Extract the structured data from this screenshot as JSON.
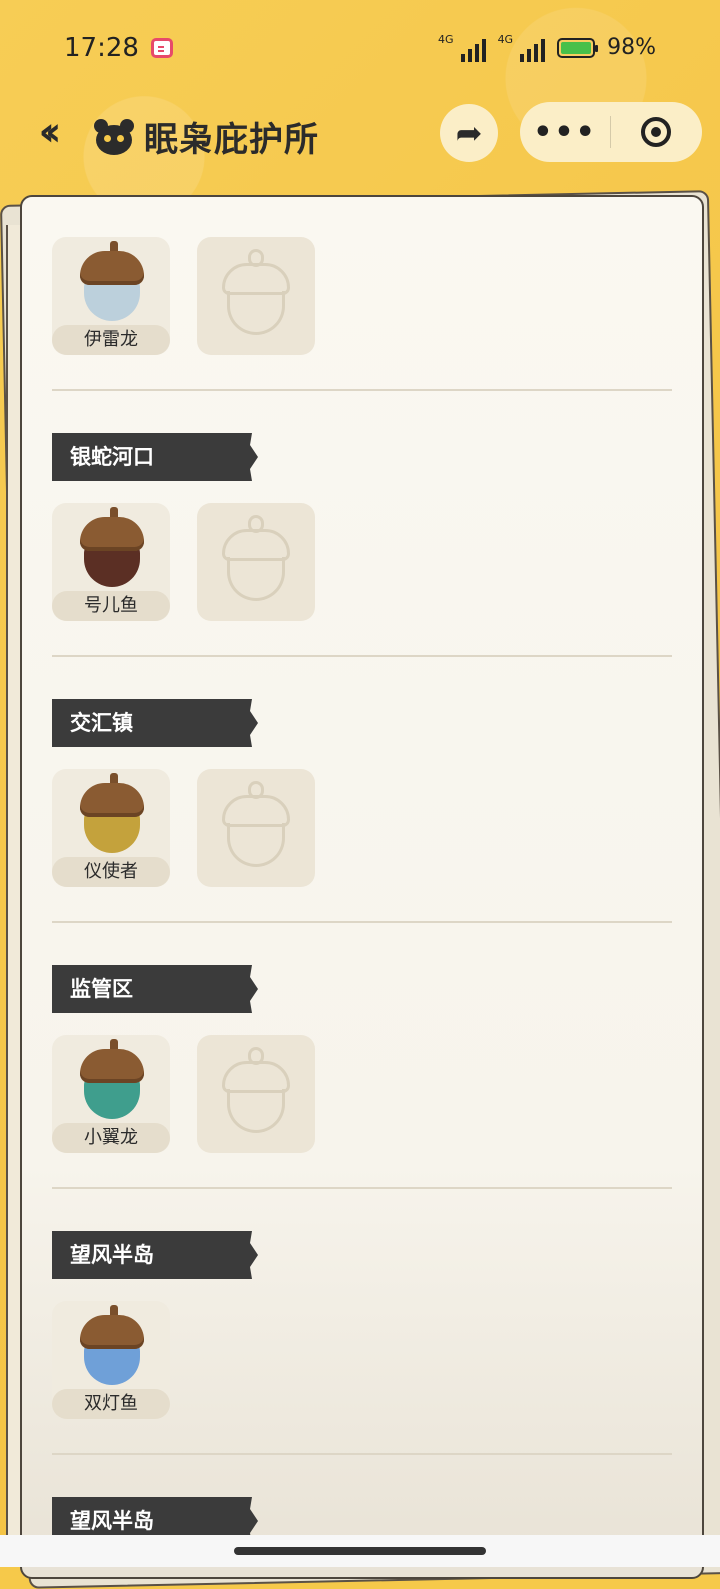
{
  "status_bar": {
    "time": "17:28",
    "network1": "4G",
    "network2": "4G",
    "battery": "98%"
  },
  "nav": {
    "title": "眠枭庇护所"
  },
  "sections": [
    {
      "region": "",
      "items": [
        {
          "name": "伊雷龙",
          "body_color": "#bcd0dc",
          "filled": true
        },
        {
          "filled": false
        }
      ]
    },
    {
      "region": "银蛇河口",
      "items": [
        {
          "name": "号儿鱼",
          "body_color": "#5b2f24",
          "filled": true
        },
        {
          "filled": false
        }
      ]
    },
    {
      "region": "交汇镇",
      "items": [
        {
          "name": "仪使者",
          "body_color": "#c4a23c",
          "filled": true
        },
        {
          "filled": false
        }
      ]
    },
    {
      "region": "监管区",
      "items": [
        {
          "name": "小翼龙",
          "body_color": "#3f9e8d",
          "filled": true
        },
        {
          "filled": false
        }
      ]
    },
    {
      "region": "望风半岛",
      "items": [
        {
          "name": "双灯鱼",
          "body_color": "#6fa0d8",
          "filled": true
        }
      ]
    },
    {
      "region": "望风半岛",
      "items": []
    }
  ]
}
